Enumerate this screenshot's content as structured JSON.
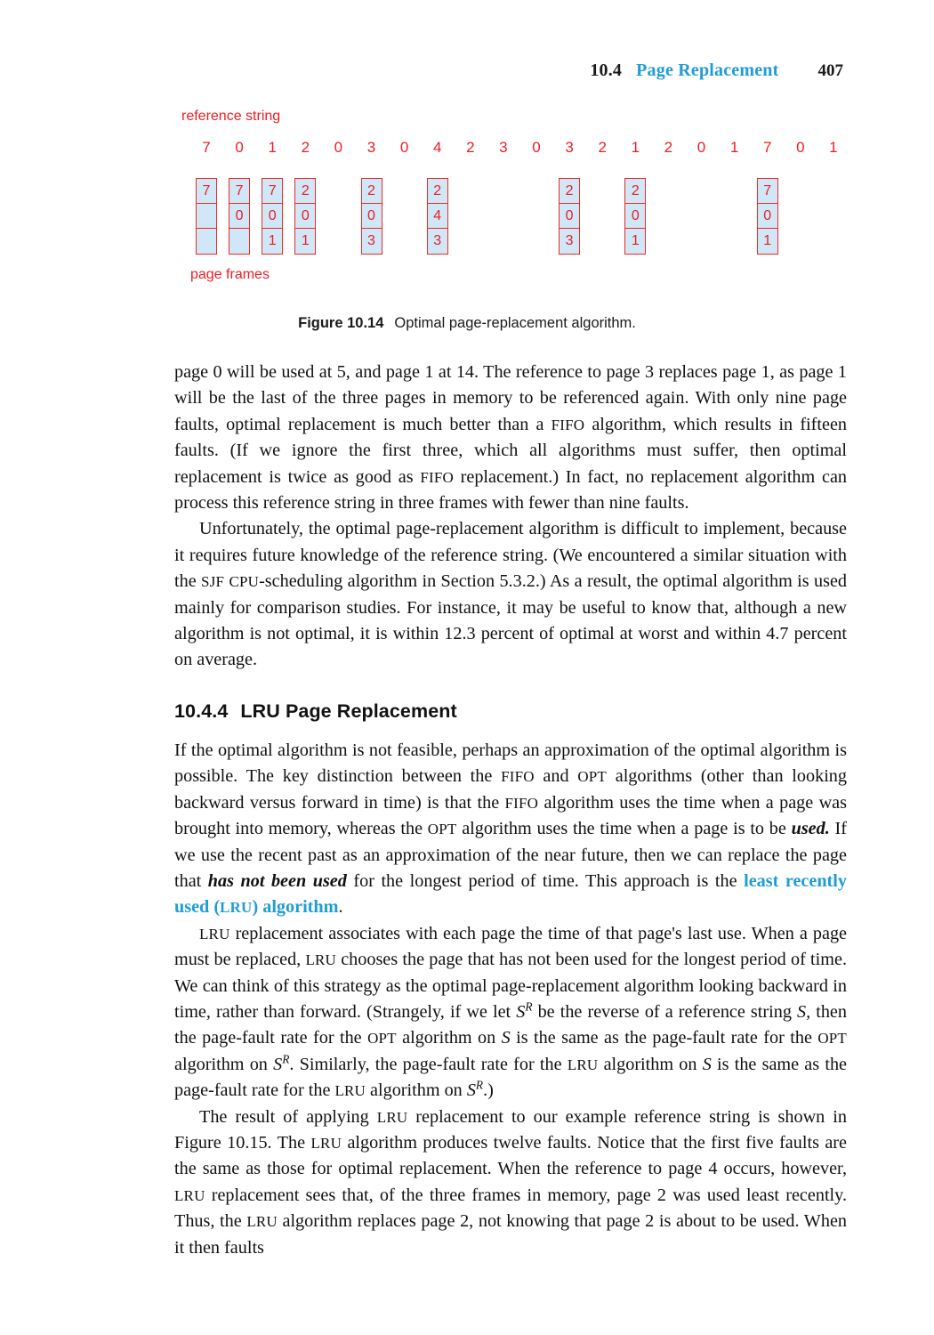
{
  "running_head": {
    "section_number": "10.4",
    "section_title": "Page Replacement",
    "page_number": "407",
    "accent_color": "#1f9cd6"
  },
  "figure": {
    "reference_string_label": "reference string",
    "page_frames_label": "page frames",
    "reference_string": [
      "7",
      "0",
      "1",
      "2",
      "0",
      "3",
      "0",
      "4",
      "2",
      "3",
      "0",
      "3",
      "2",
      "1",
      "2",
      "0",
      "1",
      "7",
      "0",
      "1"
    ],
    "frame_columns": [
      {
        "position": 1,
        "cells": [
          "7",
          "",
          ""
        ]
      },
      {
        "position": 2,
        "cells": [
          "7",
          "0",
          ""
        ]
      },
      {
        "position": 3,
        "cells": [
          "7",
          "0",
          "1"
        ]
      },
      {
        "position": 4,
        "cells": [
          "2",
          "0",
          "1"
        ]
      },
      {
        "position": 6,
        "cells": [
          "2",
          "0",
          "3"
        ]
      },
      {
        "position": 8,
        "cells": [
          "2",
          "4",
          "3"
        ]
      },
      {
        "position": 12,
        "cells": [
          "2",
          "0",
          "3"
        ]
      },
      {
        "position": 14,
        "cells": [
          "2",
          "0",
          "1"
        ]
      },
      {
        "position": 18,
        "cells": [
          "7",
          "0",
          "1"
        ]
      }
    ],
    "box_fill_color": "#cfe7f7",
    "box_border_color": "#ee2a22",
    "text_color": "#ee1c25",
    "caption_label": "Figure 10.14",
    "caption_text": "Optimal page-replacement algorithm."
  },
  "content": {
    "para1": "page 0 will be used at 5, and page 1 at 14. The reference to page 3 replaces page 1, as page 1 will be the last of the three pages in memory to be referenced again. With only nine page faults, optimal replacement is much better than a FIFO algorithm, which results in fifteen faults. (If we ignore the first three, which all algorithms must suffer, then optimal replacement is twice as good as FIFO replacement.) In fact, no replacement algorithm can process this reference string in three frames with fewer than nine faults.",
    "para2": "Unfortunately, the optimal page-replacement algorithm is difficult to implement, because it requires future knowledge of the reference string. (We encountered a similar situation with the SJF CPU-scheduling algorithm in Section 5.3.2.) As a result, the optimal algorithm is used mainly for comparison studies. For instance, it may be useful to know that, although a new algorithm is not optimal, it is within 12.3 percent of optimal at worst and within 4.7 percent on average.",
    "section_heading_number": "10.4.4",
    "section_heading_title": "LRU Page Replacement",
    "para3": "If the optimal algorithm is not feasible, perhaps an approximation of the optimal algorithm is possible. The key distinction between the FIFO and OPT algorithms (other than looking backward versus forward in time) is that the FIFO algorithm uses the time when a page was brought into memory, whereas the OPT algorithm uses the time when a page is to be used. If we use the recent past as an approximation of the near future, then we can replace the page that has not been used for the longest period of time. This approach is the least recently used (LRU) algorithm.",
    "para4": "LRU replacement associates with each page the time of that page's last use. When a page must be replaced, LRU chooses the page that has not been used for the longest period of time. We can think of this strategy as the optimal page-replacement algorithm looking backward in time, rather than forward. (Strangely, if we let S^R be the reverse of a reference string S, then the page-fault rate for the OPT algorithm on S is the same as the page-fault rate for the OPT algorithm on S^R. Similarly, the page-fault rate for the LRU algorithm on S is the same as the page-fault rate for the LRU algorithm on S^R.)",
    "para5": "The result of applying LRU replacement to our example reference string is shown in Figure 10.15. The LRU algorithm produces twelve faults. Notice that the first five faults are the same as those for optimal replacement. When the reference to page 4 occurs, however, LRU replacement sees that, of the three frames in memory, page 2 was used least recently. Thus, the LRU algorithm replaces page 2, not knowing that page 2 is about to be used. When it then faults"
  }
}
